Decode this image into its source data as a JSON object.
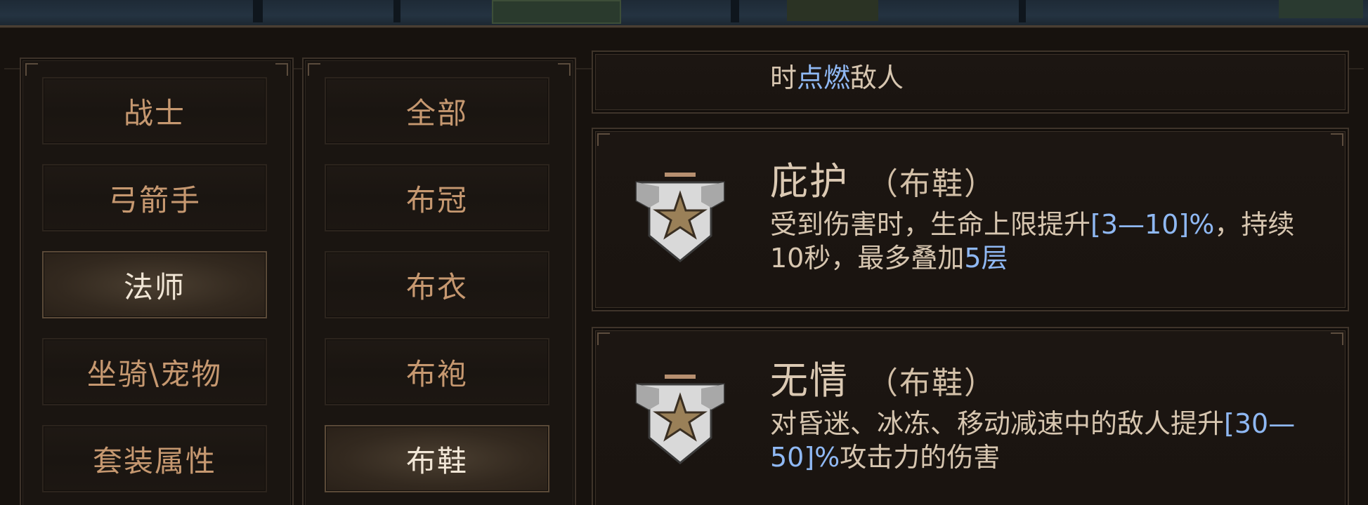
{
  "categories": [
    {
      "label": "战士",
      "active": false
    },
    {
      "label": "弓箭手",
      "active": false
    },
    {
      "label": "法师",
      "active": true
    },
    {
      "label": "坐骑\\宠物",
      "active": false
    },
    {
      "label": "套装属性",
      "active": false
    }
  ],
  "subcategories": [
    {
      "label": "全部",
      "active": false
    },
    {
      "label": "布冠",
      "active": false
    },
    {
      "label": "布衣",
      "active": false
    },
    {
      "label": "布袍",
      "active": false
    },
    {
      "label": "布鞋",
      "active": true
    }
  ],
  "items": {
    "partial": {
      "desc_prefix": "时",
      "desc_hl": "点燃",
      "desc_suffix": "敌人"
    },
    "shelter": {
      "name": "庇护",
      "slot": "（布鞋）",
      "desc_1": "受到伤害时，生命上限提升",
      "desc_hl_1": "[3—10]%",
      "desc_2": "，持续10秒，最多叠加",
      "desc_hl_2": "5层",
      "icon": "eagle-star-emblem-icon"
    },
    "ruthless": {
      "name": "无情",
      "slot": "（布鞋）",
      "desc_1": "对昏迷、冰冻、移动减速中的敌人提升",
      "desc_hl_1": "[30—50]%",
      "desc_2": "攻击力的伤害",
      "icon": "eagle-star-emblem-icon"
    }
  },
  "colors": {
    "text_default": "#c69870",
    "text_active": "#f1e6d6",
    "highlight": "#8fb8f3",
    "panel_bg": "#17120e"
  }
}
